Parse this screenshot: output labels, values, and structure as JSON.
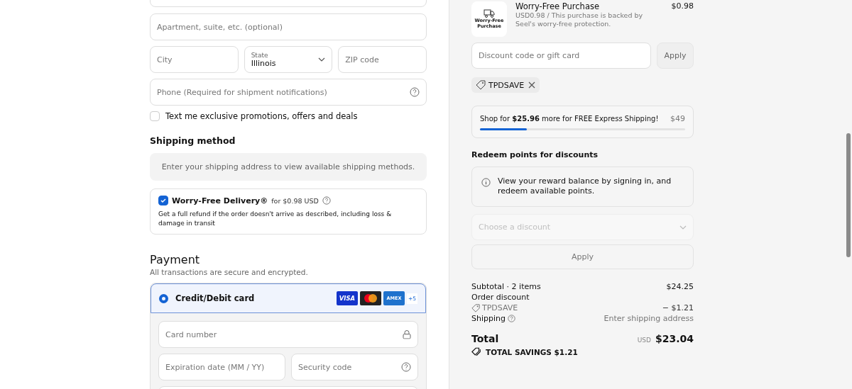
{
  "address": {
    "apartment": {
      "placeholder": "Apartment, suite, etc. (optional)"
    },
    "city": {
      "placeholder": "City"
    },
    "state": {
      "label": "State",
      "value": "Illinois"
    },
    "zip": {
      "placeholder": "ZIP code"
    },
    "phone": {
      "placeholder": "Phone (Required for shipment notifications)"
    },
    "promotions": {
      "label": "Text me exclusive promotions, offers and deals",
      "checked": false
    }
  },
  "shipping_method": {
    "title": "Shipping method",
    "notice": "Enter your shipping address to view available shipping methods."
  },
  "worry_free": {
    "checked": true,
    "title": "Worry-Free Delivery®",
    "price": "for $0.98 USD",
    "description": "Get a full refund if the order doesn't arrive as described, including loss & damage in transit"
  },
  "payment": {
    "title": "Payment",
    "subtitle": "All transactions are secure and encrypted.",
    "method": {
      "label": "Credit/Debit card",
      "selected": true,
      "more_cards": "+5",
      "amex": "AMEX",
      "visa": "VISA"
    },
    "card_number": {
      "placeholder": "Card number"
    },
    "expiration": {
      "placeholder": "Expiration date (MM / YY)"
    },
    "security": {
      "placeholder": "Security code"
    }
  },
  "summary": {
    "item": {
      "badge": "Worry-Free Purchase",
      "title": "Worry-Free Purchase",
      "description": "USD0.98 / This purchase is backed by Seel's worry-free protection.",
      "price": "$0.98"
    },
    "discount": {
      "placeholder": "Discount code or gift card",
      "button": "Apply",
      "tag": "TPDSAVE"
    },
    "free_shipping": {
      "text": "Shop for **$25.96** more for FREE Express Shipping!",
      "goal": "$49",
      "level": 0.23
    },
    "redeem": {
      "title": "Redeem points for discounts",
      "info": "View your reward balance by signing in, and redeem available points.",
      "select_placeholder": "Choose a discount",
      "button": "Apply"
    },
    "lines": [
      {
        "kind": "plain",
        "label": "Subtotal · 2 items",
        "value": "$24.25"
      },
      {
        "kind": "discount",
        "label": "Order discount",
        "code": "TPDSAVE",
        "value": "− $1.21"
      },
      {
        "kind": "help",
        "label": "Shipping",
        "value": "Enter shipping address"
      }
    ],
    "total": {
      "label": "Total",
      "currency": "USD",
      "value": "$23.04",
      "savings": "TOTAL SAVINGS $1.21"
    }
  }
}
